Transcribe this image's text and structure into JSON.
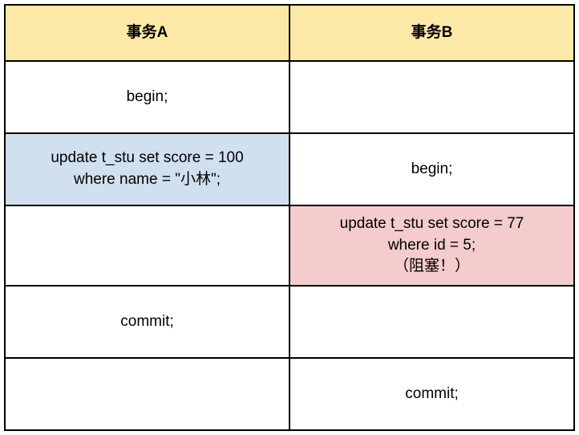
{
  "headers": {
    "colA": "事务A",
    "colB": "事务B"
  },
  "rows": [
    {
      "a": "begin;",
      "b": ""
    },
    {
      "a": "update t_stu set score = 100 where name = \"小林\";",
      "b": "begin;",
      "aHighlight": "blue"
    },
    {
      "a": "",
      "b": "update t_stu set score = 77 where id = 5;\n（阻塞！）",
      "bHighlight": "red"
    },
    {
      "a": "commit;",
      "b": ""
    },
    {
      "a": "",
      "b": "commit;"
    }
  ]
}
